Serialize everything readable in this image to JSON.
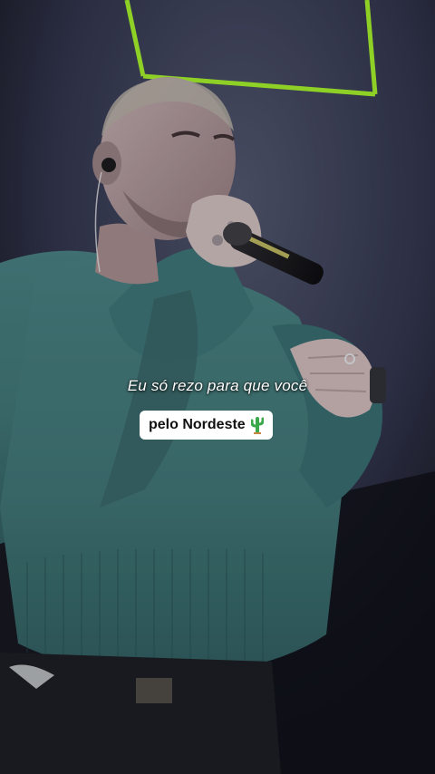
{
  "caption": {
    "line": "Eu só rezo para que você",
    "highlight": "pelo Nordeste",
    "highlight_emoji": "cactus-icon"
  },
  "colors": {
    "neon_frame": "#9be22a",
    "sweater": "#3f7373",
    "highlight_bg": "#ffffff"
  }
}
